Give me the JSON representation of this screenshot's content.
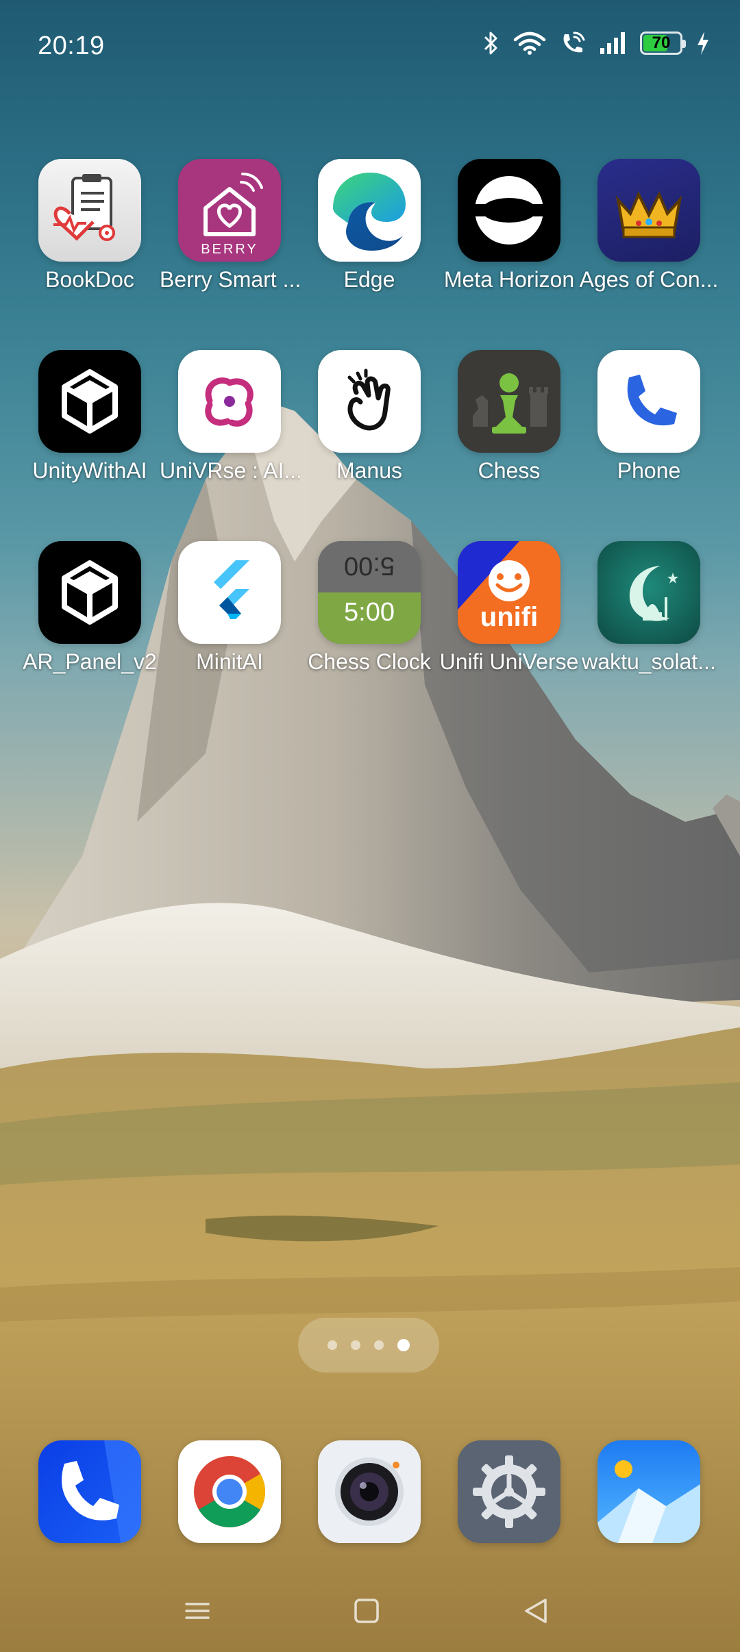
{
  "status_bar": {
    "time": "20:19",
    "battery_level": "70",
    "battery_percent": 70,
    "icons": [
      "bluetooth-icon",
      "wifi-icon",
      "wifi-calling-icon",
      "cellular-signal-icon",
      "battery-icon",
      "charging-bolt-icon"
    ]
  },
  "apps": {
    "row1": [
      "BookDoc",
      "Berry Smart ...",
      "Edge",
      "Meta Horizon",
      "Ages of Con..."
    ],
    "row2": [
      "UnityWithAI",
      "UniVRse : AI...",
      "Manus",
      "Chess",
      "Phone"
    ],
    "row3": [
      "AR_Panel_v2",
      "MinitAI",
      "Chess Clock",
      "Unifi UniVerse",
      "waktu_solat..."
    ]
  },
  "icon_text": {
    "berry": "BERRY",
    "chess_clock_top": "5:00",
    "chess_clock_bottom": "5:00",
    "unifi": "unifi"
  },
  "page_indicator": {
    "total": 4,
    "current": 4
  },
  "dock": [
    "phone-dialer",
    "chrome",
    "camera",
    "settings",
    "gallery"
  ],
  "navigation": [
    "menu-button",
    "home-button",
    "back-button"
  ],
  "colors": {
    "battery_fill": "#2ecc40",
    "berry": "#a8367f",
    "unifi": "#f36e21",
    "chess_green": "#7cc242"
  }
}
